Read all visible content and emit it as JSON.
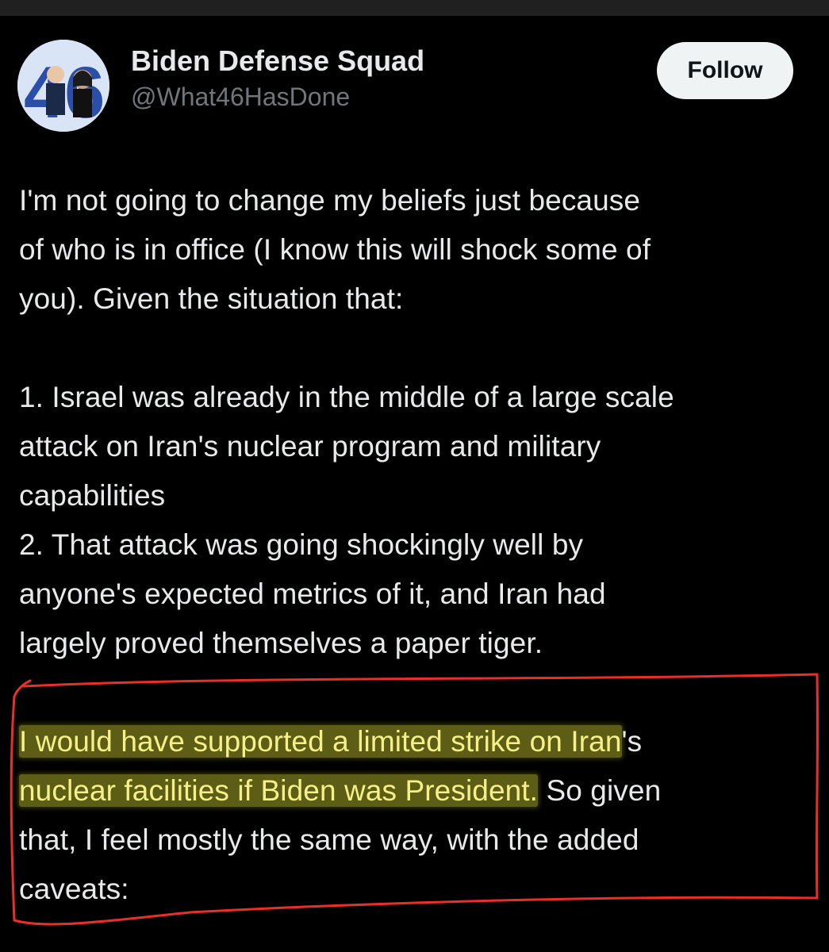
{
  "account": {
    "display_name": "Biden Defense Squad",
    "handle": "@What46HasDone",
    "avatar_text": "46"
  },
  "follow_label": "Follow",
  "tweet": {
    "para1_lines": [
      "I'm not going to change my beliefs just because",
      "of who is in office (I know this will shock some of",
      "you). Given the situation that:"
    ],
    "para2_lines": [
      "1. Israel was already in the middle of a large scale",
      "attack on Iran's nuclear program and military",
      "capabilities",
      "2. That attack was going shockingly well by",
      "anyone's expected metrics of it, and Iran had",
      "largely proved themselves a paper tiger."
    ],
    "para3": {
      "line1_highlight": "I would have supported a limited strike on Iran",
      "line1_rest": "'s",
      "line2_highlight": "nuclear facilities if Biden was President.",
      "line2_rest": " So given",
      "line3": "that, I feel mostly the same way, with the added",
      "line4": "caveats:"
    }
  },
  "colors": {
    "background": "#000000",
    "text": "#e7e9ea",
    "handle": "#71767b",
    "follow_bg": "#eff3f4",
    "annotation_red": "#e8302a",
    "highlight": "#b7b335"
  }
}
